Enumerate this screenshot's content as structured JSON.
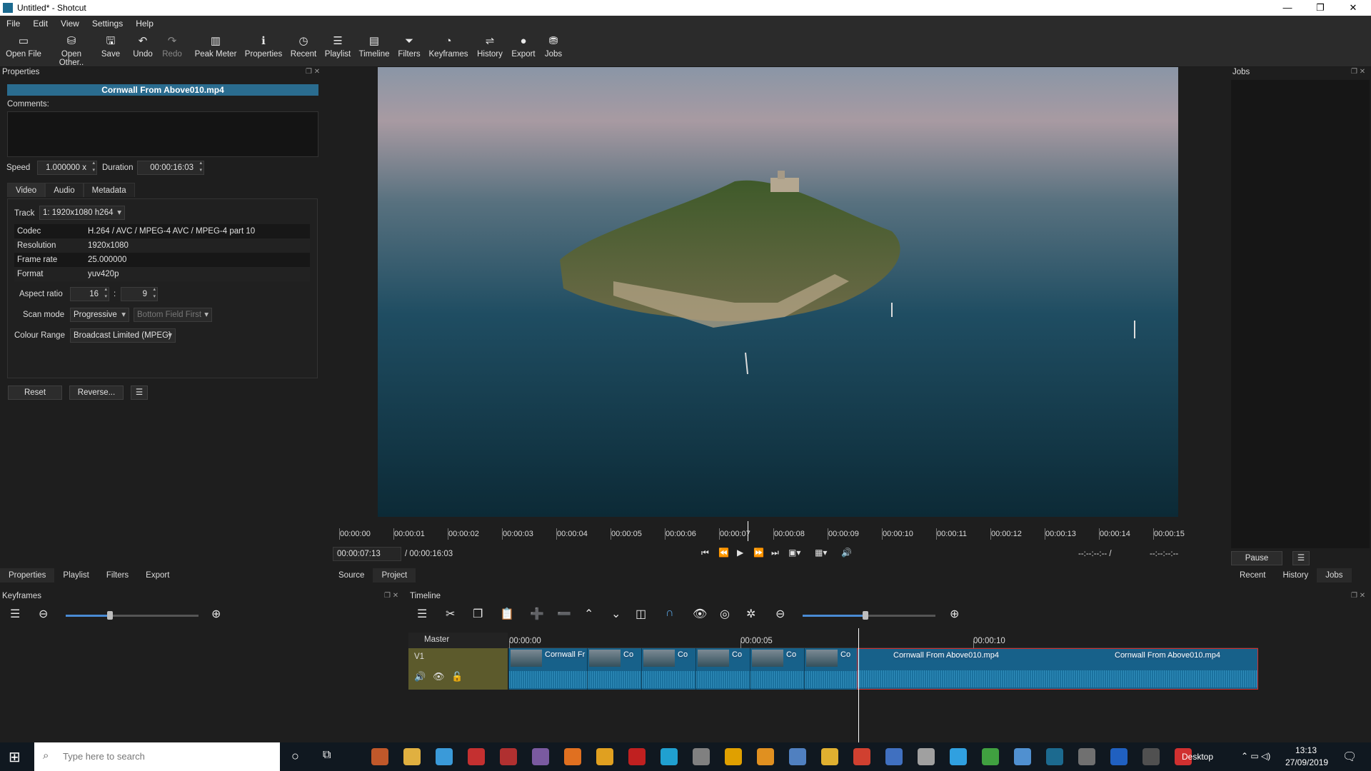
{
  "window": {
    "title": "Untitled* - Shotcut",
    "controls": [
      "—",
      "❐",
      "✕"
    ]
  },
  "menu": [
    "File",
    "Edit",
    "View",
    "Settings",
    "Help"
  ],
  "toolbar": [
    {
      "label": "Open File",
      "icon": "open-file-icon",
      "glyph": "▭"
    },
    {
      "label": "Open Other..",
      "icon": "open-other-icon",
      "glyph": "⛁"
    },
    {
      "label": "Save",
      "icon": "save-icon",
      "glyph": "🖫"
    },
    {
      "label": "Undo",
      "icon": "undo-icon",
      "glyph": "↶"
    },
    {
      "label": "Redo",
      "icon": "redo-icon",
      "glyph": "↷"
    },
    {
      "label": "Peak Meter",
      "icon": "peak-meter-icon",
      "glyph": "▥"
    },
    {
      "label": "Properties",
      "icon": "properties-icon",
      "glyph": "ℹ"
    },
    {
      "label": "Recent",
      "icon": "recent-icon",
      "glyph": "◷"
    },
    {
      "label": "Playlist",
      "icon": "playlist-icon",
      "glyph": "☰"
    },
    {
      "label": "Timeline",
      "icon": "timeline-icon",
      "glyph": "▤"
    },
    {
      "label": "Filters",
      "icon": "filters-icon",
      "glyph": "⏷"
    },
    {
      "label": "Keyframes",
      "icon": "keyframes-icon",
      "glyph": "◔"
    },
    {
      "label": "History",
      "icon": "history-icon",
      "glyph": "⇌"
    },
    {
      "label": "Export",
      "icon": "export-icon",
      "glyph": "●"
    },
    {
      "label": "Jobs",
      "icon": "jobs-icon",
      "glyph": "⛃"
    }
  ],
  "properties": {
    "panel_title": "Properties",
    "file_name": "Cornwall From Above010.mp4",
    "comments_label": "Comments:",
    "speed_label": "Speed",
    "speed_value": "1.000000 x",
    "duration_label": "Duration",
    "duration_value": "00:00:16:03",
    "tabs": [
      "Video",
      "Audio",
      "Metadata"
    ],
    "track_label": "Track",
    "track_value": "1: 1920x1080 h264",
    "info": [
      {
        "key": "Codec",
        "value": "H.264 / AVC / MPEG-4 AVC / MPEG-4 part 10"
      },
      {
        "key": "Resolution",
        "value": "1920x1080"
      },
      {
        "key": "Frame rate",
        "value": "25.000000"
      },
      {
        "key": "Format",
        "value": "yuv420p"
      }
    ],
    "aspect_label": "Aspect ratio",
    "aspect_w": "16",
    "aspect_sep": ":",
    "aspect_h": "9",
    "scan_label": "Scan mode",
    "scan_value": "Progressive",
    "field_value": "Bottom Field First",
    "colour_label": "Colour Range",
    "colour_value": "Broadcast Limited (MPEG)",
    "reset_label": "Reset",
    "reverse_label": "Reverse...",
    "menu_glyph": "☰"
  },
  "left_tabs": [
    "Properties",
    "Playlist",
    "Filters",
    "Export"
  ],
  "player": {
    "ruler": [
      "00:00:00",
      "00:00:01",
      "00:00:02",
      "00:00:03",
      "00:00:04",
      "00:00:05",
      "00:00:06",
      "00:00:07",
      "00:00:08",
      "00:00:09",
      "00:00:10",
      "00:00:11",
      "00:00:12",
      "00:00:13",
      "00:00:14",
      "00:00:15"
    ],
    "position": "00:00:07:13",
    "total": "/ 00:00:16:03",
    "in_point": "--:--:--:-- /",
    "out_point": "--:--:--:--",
    "tabs": [
      "Source",
      "Project"
    ]
  },
  "jobs": {
    "title": "Jobs",
    "pause_label": "Pause",
    "tabs": [
      "Recent",
      "History",
      "Jobs"
    ]
  },
  "keyframes": {
    "title": "Keyframes"
  },
  "timeline": {
    "title": "Timeline",
    "master_label": "Master",
    "track_label": "V1",
    "ruler": [
      "00:00:00",
      "00:00:05",
      "00:00:10"
    ],
    "clips": [
      {
        "name": "Cornwall Fr"
      },
      {
        "name": "Co"
      },
      {
        "name": "Co"
      },
      {
        "name": "Co"
      },
      {
        "name": "Co"
      },
      {
        "name": "Co"
      },
      {
        "name": "Cornwall From Above010.mp4"
      },
      {
        "name": "Cornwall From Above010.mp4"
      }
    ]
  },
  "taskbar": {
    "search_placeholder": "Type here to search",
    "desktop_label": "Desktop",
    "time": "13:13",
    "date": "27/09/2019"
  }
}
